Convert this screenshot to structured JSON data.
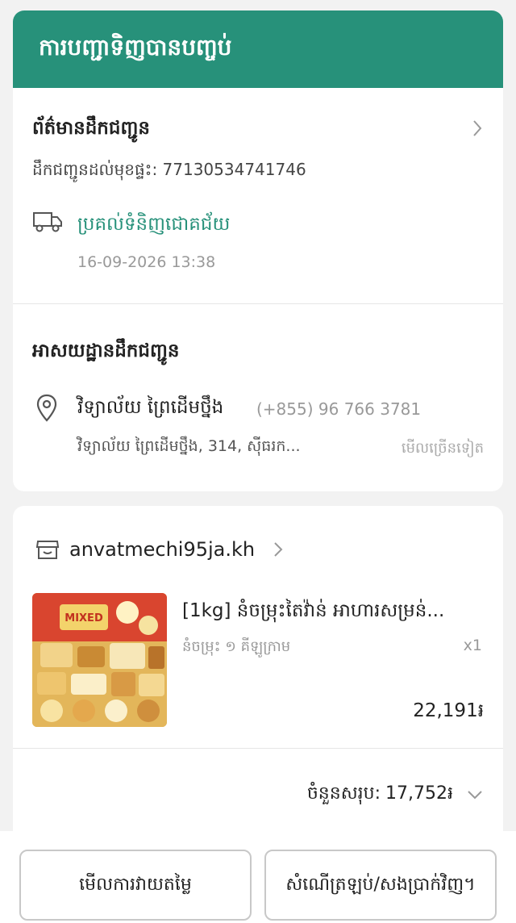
{
  "header": {
    "title": "ការបញ្ជាទិញបានបញ្ចប់"
  },
  "shipping": {
    "title": "ព័ត៌មានដឹកជញ្ជូន",
    "tracking": "ដឹកជញ្ជូនដល់មុខផ្ទះ: 77130534741746",
    "status": "ប្រគល់ទំនិញជោគជ័យ",
    "time": "16-09-2026 13:38"
  },
  "address": {
    "title": "អាសយដ្ឋានដឹកជញ្ជូន",
    "name": "វិទ្យាល័យ ព្រៃដើមថ្នឹង",
    "phone": "(+855) 96 766 3781",
    "line": "វិទ្យាល័យ ព្រៃដើមថ្នឹង, 314, ស៊ីធរក...",
    "more": "មើលច្រើនទៀត"
  },
  "shop": {
    "name": "anvatmechi95ja.kh"
  },
  "product": {
    "title": "[1kg] នំចម្រុះតៃវ៉ាន់ អាហារសម្រន់...",
    "variant": "នំចម្រុះ ១ គីឡូក្រាម",
    "qty": "x1",
    "price": "22,191៛",
    "thumb_label": "MIXED"
  },
  "summary": {
    "label": "ចំនួនសរុប:",
    "value": "17,752៛"
  },
  "actions": {
    "review": "មើលការវាយតម្លៃ",
    "return": "សំណើត្រឡប់/សងប្រាក់វិញ។"
  },
  "colors": {
    "accent": "#27917a"
  }
}
